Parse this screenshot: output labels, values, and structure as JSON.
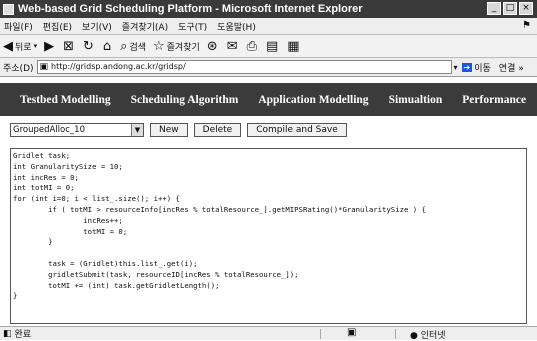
{
  "window": {
    "title": "Web-based Grid Scheduling Platform - Microsoft Internet Explorer"
  },
  "menubar": {
    "items": [
      "파일(F)",
      "편집(E)",
      "보기(V)",
      "즐겨찾기(A)",
      "도구(T)",
      "도움말(H)"
    ]
  },
  "toolbar": {
    "back_label": "뒤로",
    "search_label": "검색",
    "favorites_label": "즐겨찾기"
  },
  "address": {
    "label": "주소(D)",
    "url": "http://gridsp.andong.ac.kr/gridsp/",
    "go_label": "이동",
    "links_label": "연결 »"
  },
  "nav": {
    "items": [
      "Testbed Modelling",
      "Scheduling Algorithm",
      "Application Modelling",
      "Simualtion",
      "Performance"
    ]
  },
  "controls": {
    "select_value": "GroupedAlloc_10",
    "new_label": "New",
    "delete_label": "Delete",
    "compile_label": "Compile and Save"
  },
  "editor": {
    "code": "Gridlet task;\nint GranularitySize = 10;\nint incRes = 0;\nint totMI = 0;\nfor (int i=0; i < list_.size(); i++) {\n        if ( totMI > resourceInfo[incRes % totalResource_].getMIPSRating()*GranularitySize ) {\n                incRes++;\n                totMI = 0;\n        }\n\n        task = (Gridlet)this.list_.get(i);\n        gridletSubmit(task, resourceID[incRes % totalResource_]);\n        totMI += (int) task.getGridletLength();\n}"
  },
  "status": {
    "left": "완료",
    "zone": "인터넷"
  }
}
